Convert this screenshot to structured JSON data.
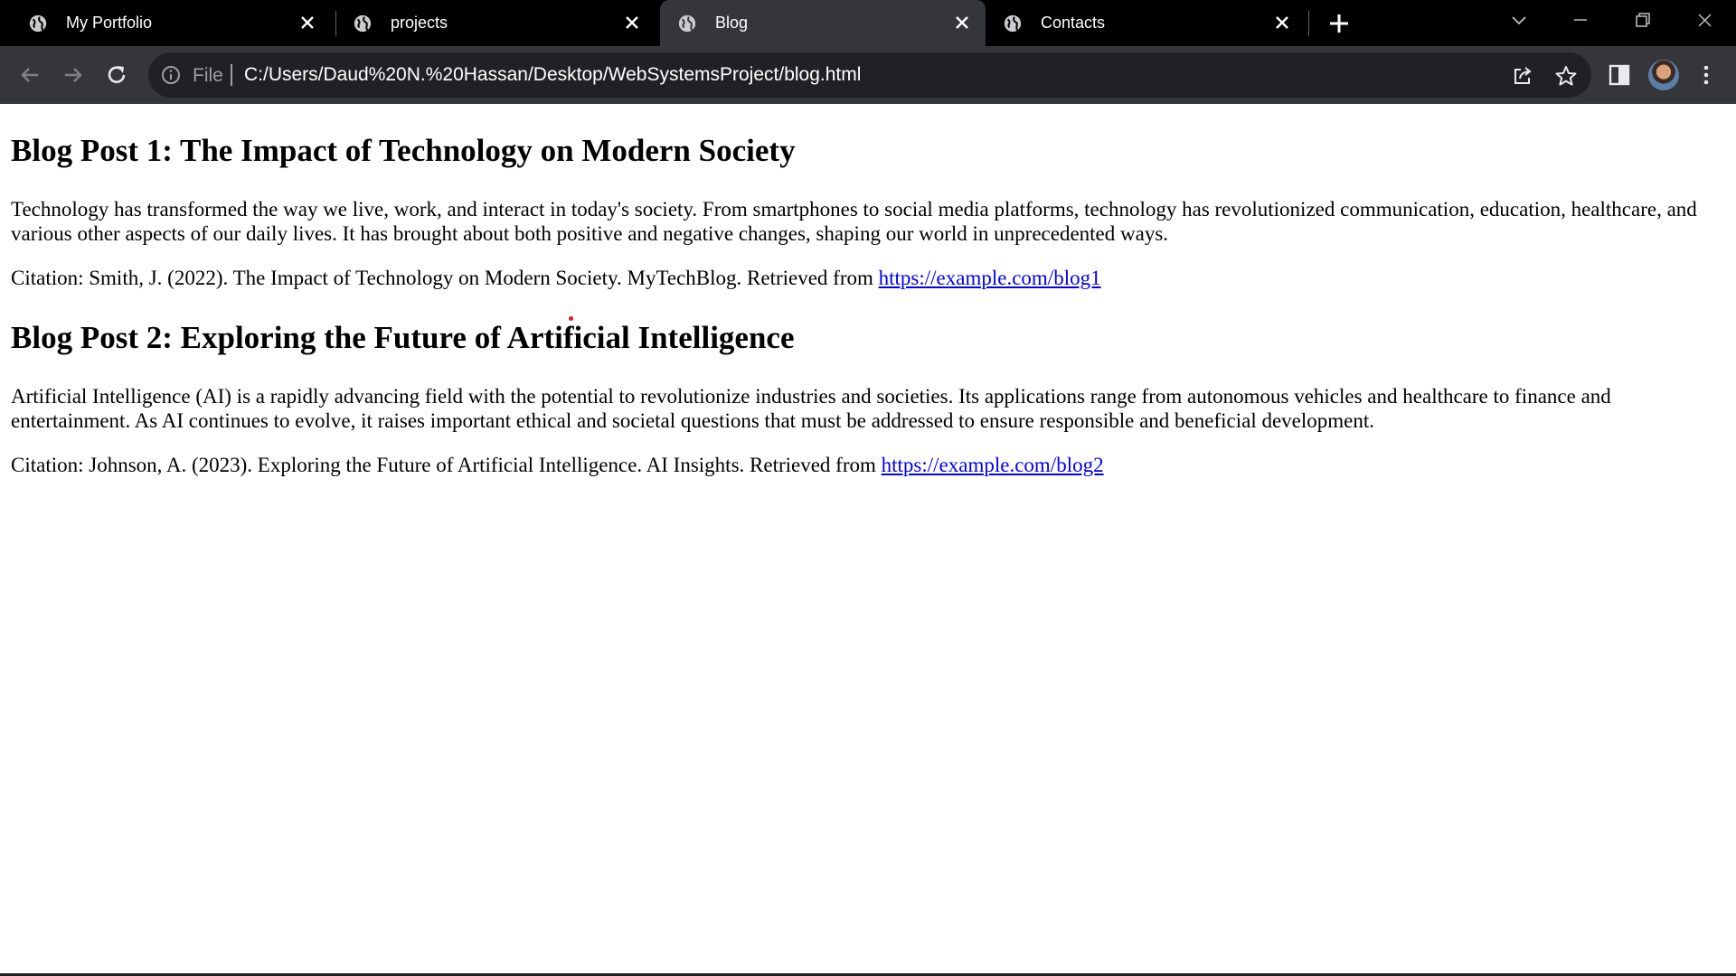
{
  "browser": {
    "tabs": [
      {
        "label": "My Portfolio",
        "active": false
      },
      {
        "label": "projects",
        "active": false
      },
      {
        "label": "Blog",
        "active": true
      },
      {
        "label": "Contacts",
        "active": false
      }
    ],
    "omnibox": {
      "scheme_label": "File",
      "url": "C:/Users/Daud%20N.%20Hassan/Desktop/WebSystemsProject/blog.html"
    },
    "icons": {
      "favicon": "globe-icon",
      "close": "close-icon",
      "new_tab": "plus-icon",
      "back": "arrow-left-icon",
      "forward": "arrow-right-icon",
      "reload": "reload-icon",
      "info": "info-icon",
      "share": "share-icon",
      "bookmark": "star-icon",
      "side_panel": "side-panel-icon",
      "menu": "kebab-menu-icon",
      "tab_search": "chevron-down-icon",
      "minimize": "minimize-icon",
      "restore": "restore-icon",
      "window_close": "close-icon"
    },
    "colors": {
      "tabstrip": "#000000",
      "toolbar": "#35363a",
      "omnibox": "#202124",
      "link": "#0000ee"
    }
  },
  "page": {
    "posts": [
      {
        "title": "Blog Post 1: The Impact of Technology on Modern Society",
        "body": "Technology has transformed the way we live, work, and interact in today's society. From smartphones to social media platforms, technology has revolutionized communication, education, healthcare, and various other aspects of our daily lives. It has brought about both positive and negative changes, shaping our world in unprecedented ways.",
        "citation_text": "Citation: Smith, J. (2022). The Impact of Technology on Modern Society. MyTechBlog. Retrieved from ",
        "citation_link": "https://example.com/blog1"
      },
      {
        "title": "Blog Post 2: Exploring the Future of Artificial Intelligence",
        "body": "Artificial Intelligence (AI) is a rapidly advancing field with the potential to revolutionize industries and societies. Its applications range from autonomous vehicles and healthcare to finance and entertainment. As AI continues to evolve, it raises important ethical and societal questions that must be addressed to ensure responsible and beneficial development.",
        "citation_text": "Citation: Johnson, A. (2023). Exploring the Future of Artificial Intelligence. AI Insights. Retrieved from ",
        "citation_link": "https://example.com/blog2"
      }
    ]
  }
}
